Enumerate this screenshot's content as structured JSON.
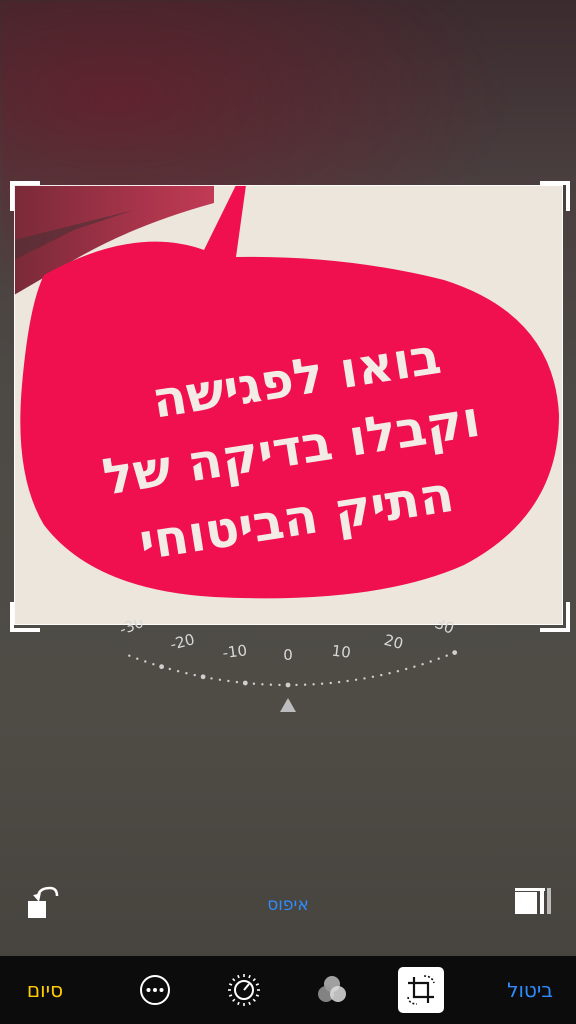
{
  "editor": {
    "photo_text": {
      "line1": "בואו לפגישה",
      "line2": "וקבלו בדיקה של",
      "line3": "התיק הביטוחי"
    },
    "straighten_dial": {
      "labels": [
        "-30",
        "-20",
        "-10",
        "0",
        "10",
        "20",
        "30"
      ],
      "current_angle": 0
    },
    "reset_label": "איפוס"
  },
  "toolbar": {
    "done_label": "סיום",
    "cancel_label": "ביטול",
    "tools": [
      "more-options-icon",
      "adjust-dial-icon",
      "filters-icon",
      "crop-rotate-icon"
    ],
    "active_tool": "crop-rotate-icon"
  },
  "colors": {
    "accent_blue": "#2f8cff",
    "done_yellow": "#ffcc00",
    "bubble_pink": "#f0104f",
    "photo_text": "#f3ece6"
  }
}
